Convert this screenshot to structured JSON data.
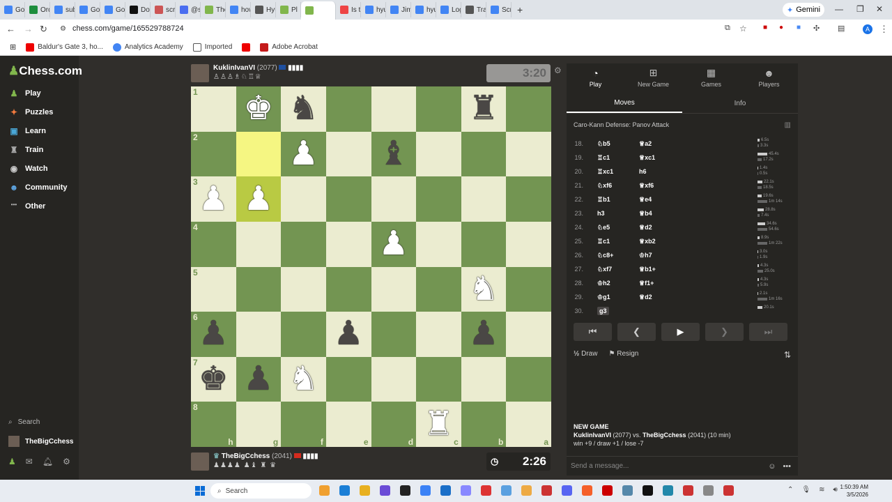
{
  "browser": {
    "tabs": [
      "Goog",
      "Order",
      "subw",
      "Goog",
      "Goog",
      "Docto",
      "scrabl",
      "@sof",
      "TheBi",
      "how c",
      "Hyun",
      "Pl",
      "",
      "Is the",
      "hyun",
      "Jimmy",
      "hyun",
      "Login",
      "Track",
      "Scrab"
    ],
    "gemini_label": "Gemini",
    "url": "chess.com/game/165529788724",
    "bookmarks": [
      "Baldur's Gate 3, ho...",
      "Analytics Academy",
      "Imported",
      "Adobe Acrobat"
    ]
  },
  "sidebar": {
    "logo": "Chess.com",
    "items": [
      {
        "icon": "play-icon",
        "label": "Play"
      },
      {
        "icon": "puzzles-icon",
        "label": "Puzzles"
      },
      {
        "icon": "learn-icon",
        "label": "Learn"
      },
      {
        "icon": "train-icon",
        "label": "Train"
      },
      {
        "icon": "watch-icon",
        "label": "Watch"
      },
      {
        "icon": "community-icon",
        "label": "Community"
      },
      {
        "icon": "more-icon",
        "label": "Other"
      }
    ],
    "search_label": "Search",
    "username": "TheBigCchess"
  },
  "top_player": {
    "name": "KuklinIvanVI",
    "rating": "(2077)",
    "captured": "♙♙♙♗♘♖♕",
    "clock": "3:20"
  },
  "bottom_player": {
    "name": "TheBigCchess",
    "rating": "(2041)",
    "captured": "♟♟♟♟ ♟♝ ♜ ♛",
    "clock": "2:26"
  },
  "board": {
    "ranks": [
      "1",
      "2",
      "3",
      "4",
      "5",
      "6",
      "7",
      "8"
    ],
    "files": [
      "h",
      "g",
      "f",
      "e",
      "d",
      "c",
      "b",
      "a"
    ],
    "squares": [
      [
        "",
        "wK",
        "bN",
        "",
        "",
        "",
        "bR",
        ""
      ],
      [
        "",
        "",
        "wP",
        "",
        "bB",
        "",
        "",
        ""
      ],
      [
        "wP",
        "wP",
        "",
        "",
        "",
        "",
        "",
        ""
      ],
      [
        "",
        "",
        "",
        "",
        "wP",
        "",
        "",
        ""
      ],
      [
        "",
        "",
        "",
        "",
        "",
        "",
        "wN",
        ""
      ],
      [
        "bP",
        "",
        "",
        "bP",
        "",
        "",
        "bP",
        ""
      ],
      [
        "bK",
        "bP",
        "wN",
        "",
        "",
        "",
        "",
        ""
      ],
      [
        "",
        "",
        "",
        "",
        "",
        "wR",
        "",
        ""
      ]
    ],
    "highlight": [
      [
        1,
        1
      ],
      [
        2,
        1
      ]
    ]
  },
  "panel": {
    "tabs": [
      {
        "icon": "stopwatch-icon",
        "label": "Play"
      },
      {
        "icon": "new-game-icon",
        "label": "New Game"
      },
      {
        "icon": "games-icon",
        "label": "Games"
      },
      {
        "icon": "players-icon",
        "label": "Players"
      }
    ],
    "subtabs": [
      "Moves",
      "Info"
    ],
    "opening": "Caro-Kann Defense: Panov Attack",
    "moves": [
      {
        "n": "18.",
        "w": "♘b5",
        "b": "♕a2",
        "tw": "6.5s",
        "tb": "3.3s",
        "ww": 3,
        "bw": 2
      },
      {
        "n": "19.",
        "w": "♖c1",
        "b": "♕xc1",
        "tw": "45.4s",
        "tb": "17.2s",
        "ww": 14,
        "bw": 6
      },
      {
        "n": "20.",
        "w": "♖xc1",
        "b": "h6",
        "tw": "1.4s",
        "tb": "0.5s",
        "ww": 1,
        "bw": 1
      },
      {
        "n": "21.",
        "w": "♘xf6",
        "b": "♕xf6",
        "tw": "22.1s",
        "tb": "18.5s",
        "ww": 7,
        "bw": 6
      },
      {
        "n": "22.",
        "w": "♖b1",
        "b": "♕e4",
        "tw": "19.6s",
        "tb": "1m 14s",
        "ww": 6,
        "bw": 14
      },
      {
        "n": "23.",
        "w": "h3",
        "b": "♕b4",
        "tw": "28.8s",
        "tb": "7.4s",
        "ww": 9,
        "bw": 3
      },
      {
        "n": "24.",
        "w": "♘e5",
        "b": "♕d2",
        "tw": "34.6s",
        "tb": "54.6s",
        "ww": 11,
        "bw": 14
      },
      {
        "n": "25.",
        "w": "♖c1",
        "b": "♕xb2",
        "tw": "8.9s",
        "tb": "1m 22s",
        "ww": 3,
        "bw": 14
      },
      {
        "n": "26.",
        "w": "♘c8+",
        "b": "♔h7",
        "tw": "3.0s",
        "tb": "1.9s",
        "ww": 1,
        "bw": 1
      },
      {
        "n": "27.",
        "w": "♘xf7",
        "b": "♕b1+",
        "tw": "4.3s",
        "tb": "25.0s",
        "ww": 2,
        "bw": 8
      },
      {
        "n": "28.",
        "w": "♔h2",
        "b": "♕f1+",
        "tw": "4.3s",
        "tb": "5.9s",
        "ww": 2,
        "bw": 2
      },
      {
        "n": "29.",
        "w": "♔g1",
        "b": "♕d2",
        "tw": "2.1s",
        "tb": "1m 16s",
        "ww": 1,
        "bw": 14
      },
      {
        "n": "30.",
        "w": "g3",
        "b": "",
        "tw": "20.1s",
        "tb": "",
        "ww": 7,
        "bw": 0
      }
    ],
    "draw_label": "Draw",
    "resign_label": "Resign",
    "new_game_title": "NEW GAME",
    "new_game_line1_a": "KuklinIvanVI",
    "new_game_line1_b": " (2077) vs. ",
    "new_game_line1_c": "TheBigCchess",
    "new_game_line1_d": " (2041) (10 min)",
    "new_game_line2": "win +9 / draw +1 / lose -7",
    "message_placeholder": "Send a message..."
  },
  "taskbar": {
    "search_label": "Search",
    "time": "1:50:39 AM",
    "date": "3/5/2026"
  }
}
